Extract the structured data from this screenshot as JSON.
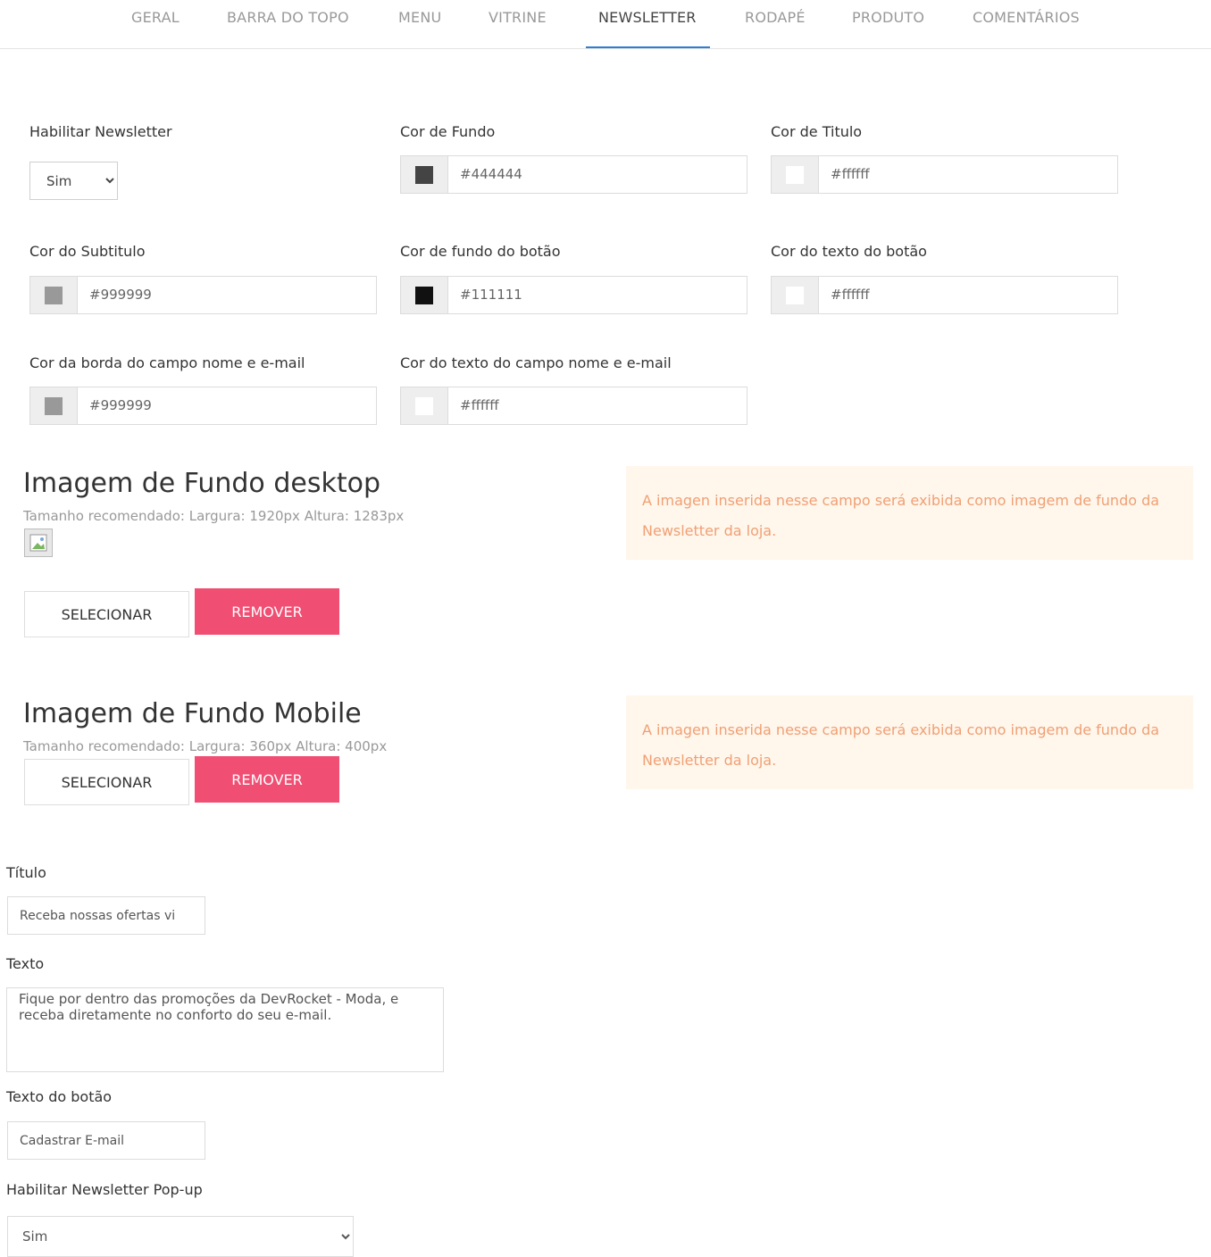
{
  "tabs": [
    {
      "label": "GERAL"
    },
    {
      "label": "BARRA DO TOPO"
    },
    {
      "label": "MENU"
    },
    {
      "label": "VITRINE"
    },
    {
      "label": "NEWSLETTER",
      "active": true
    },
    {
      "label": "RODAPÉ"
    },
    {
      "label": "PRODUTO"
    },
    {
      "label": "COMENTÁRIOS"
    }
  ],
  "fields": {
    "habilitar_newsletter": {
      "label": "Habilitar Newsletter",
      "value": "Sim"
    },
    "cor_fundo": {
      "label": "Cor de Fundo",
      "value": "#444444",
      "swatch": "#444444"
    },
    "cor_titulo": {
      "label": "Cor de Titulo",
      "value": "#ffffff",
      "swatch": "#ffffff"
    },
    "cor_subtitulo": {
      "label": "Cor do Subtitulo",
      "value": "#999999",
      "swatch": "#999999"
    },
    "cor_fundo_botao": {
      "label": "Cor de fundo do botão",
      "value": "#111111",
      "swatch": "#111111"
    },
    "cor_texto_botao": {
      "label": "Cor do texto do botão",
      "value": "#ffffff",
      "swatch": "#ffffff"
    },
    "cor_borda_campo": {
      "label": "Cor da borda do campo nome e e-mail",
      "value": "#999999",
      "swatch": "#999999"
    },
    "cor_texto_campo": {
      "label": "Cor do texto do campo nome e e-mail",
      "value": "#ffffff",
      "swatch": "#ffffff"
    }
  },
  "desktop": {
    "title": "Imagem de Fundo desktop",
    "hint": "Tamanho recomendado: Largura: 1920px Altura: 1283px",
    "select_label": "SELECIONAR",
    "remove_label": "REMOVER",
    "notice": "A imagen inserida nesse campo será exibida como imagem de fundo da Newsletter da loja."
  },
  "mobile": {
    "title": "Imagem de Fundo Mobile",
    "hint": "Tamanho recomendado: Largura: 360px Altura: 400px",
    "select_label": "SELECIONAR",
    "remove_label": "REMOVER",
    "notice": "A imagen inserida nesse campo será exibida como imagem de fundo da Newsletter da loja."
  },
  "titulo": {
    "label": "Título",
    "value": "Receba nossas ofertas vi"
  },
  "texto": {
    "label": "Texto",
    "value": "Fique por dentro das promoções da DevRocket - Moda, e receba diretamente no conforto do seu e-mail."
  },
  "texto_botao": {
    "label": "Texto do botão",
    "value": "Cadastrar E-mail"
  },
  "popup": {
    "label": "Habilitar Newsletter Pop-up",
    "value": "Sim"
  },
  "colors": {
    "accent": "#f04f73",
    "tab_underline": "#2f7fcf",
    "notice_bg": "#fff6ec",
    "notice_text": "#f0a074"
  }
}
